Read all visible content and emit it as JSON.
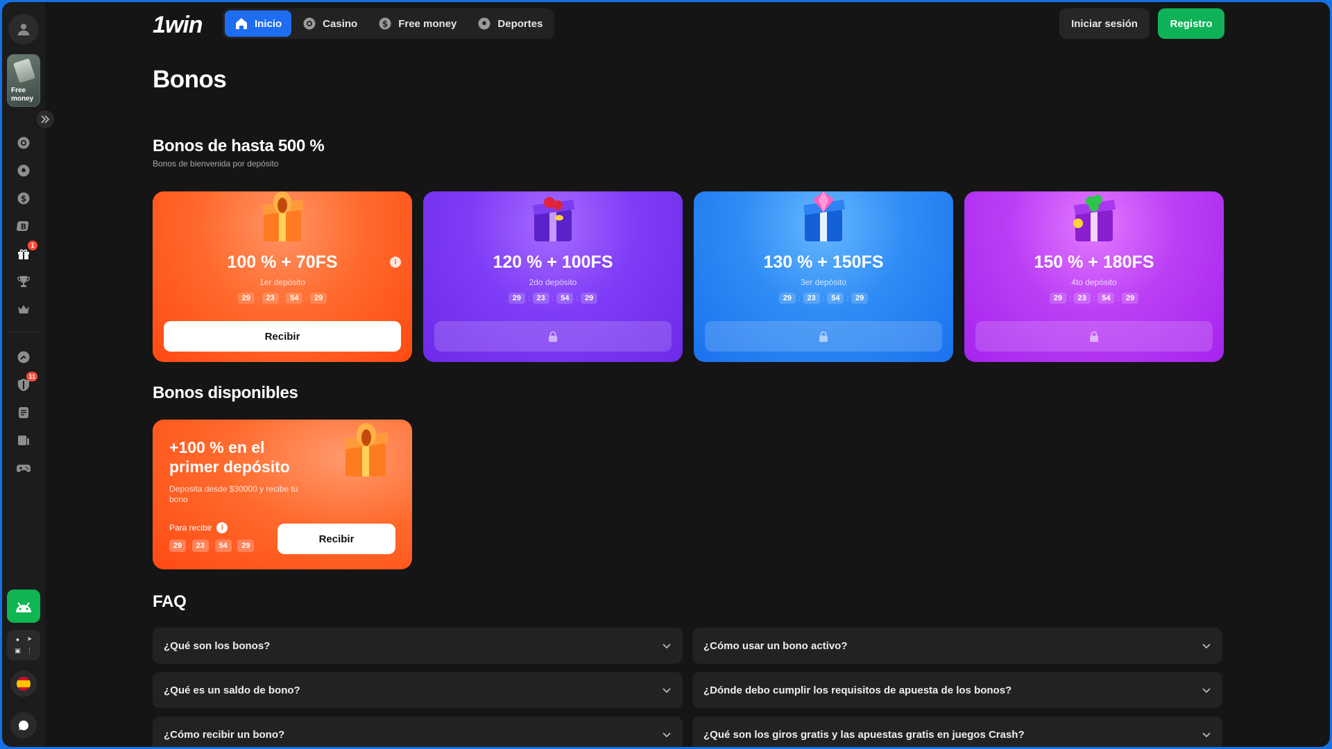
{
  "sidebar": {
    "free_money_label": "Free money",
    "gift_badge": "1",
    "shield_badge": "11"
  },
  "header": {
    "logo": "1win",
    "nav": [
      {
        "label": "Inicio",
        "icon": "home-icon",
        "active": true
      },
      {
        "label": "Casino",
        "icon": "casino-chip-icon",
        "active": false
      },
      {
        "label": "Free money",
        "icon": "dollar-coin-icon",
        "active": false
      },
      {
        "label": "Deportes",
        "icon": "soccer-ball-icon",
        "active": false
      }
    ],
    "login_label": "Iniciar sesión",
    "register_label": "Registro"
  },
  "page_title": "Bonos",
  "deposit_section": {
    "title": "Bonos de hasta 500 %",
    "subtitle": "Bonos de bienvenida por depósito",
    "cards": [
      {
        "title": "100 % + 70FS",
        "subtitle": "1er depósito",
        "timer": [
          "29",
          "23",
          "54",
          "29"
        ],
        "button": "Recibir",
        "locked": false,
        "color": "#ff6a2c"
      },
      {
        "title": "120 % + 100FS",
        "subtitle": "2do depósito",
        "timer": [
          "29",
          "23",
          "54",
          "29"
        ],
        "button": "",
        "locked": true,
        "color": "#7f3cf6"
      },
      {
        "title": "130 % + 150FS",
        "subtitle": "3er depósito",
        "timer": [
          "29",
          "23",
          "54",
          "29"
        ],
        "button": "",
        "locked": true,
        "color": "#2f8cf5"
      },
      {
        "title": "150 % + 180FS",
        "subtitle": "4to depósito",
        "timer": [
          "29",
          "23",
          "54",
          "29"
        ],
        "button": "",
        "locked": true,
        "color": "#bb3ff5"
      }
    ]
  },
  "available_section": {
    "title": "Bonos disponibles",
    "card": {
      "title": "+100 % en el primer depósito",
      "description": "Deposita desde $30000 y recibe tu bono",
      "timer_label": "Para recibir",
      "timer": [
        "29",
        "23",
        "54",
        "29"
      ],
      "button": "Recibir"
    }
  },
  "faq": {
    "title": "FAQ",
    "items": [
      "¿Qué son los bonos?",
      "¿Cómo usar un bono activo?",
      "¿Qué es un saldo de bono?",
      "¿Dónde debo cumplir los requisitos de apuesta de los bonos?",
      "¿Cómo recibir un bono?",
      "¿Qué son los giros gratis y las apuestas gratis en juegos Crash?"
    ]
  },
  "colors": {
    "accent_blue": "#1d6cf2",
    "register_green": "#10b257",
    "android_green": "#0fb652"
  }
}
